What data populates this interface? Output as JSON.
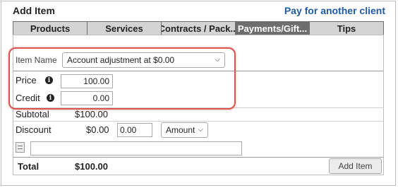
{
  "header": {
    "title": "Add Item",
    "pay_link": "Pay for another client"
  },
  "tabs": [
    {
      "label": "Products",
      "active": false
    },
    {
      "label": "Services",
      "active": false
    },
    {
      "label": "Contracts / Pack...",
      "active": false
    },
    {
      "label": "Payments/Gift...",
      "active": true
    },
    {
      "label": "Tips",
      "active": false
    }
  ],
  "form": {
    "item_name_label": "Item Name",
    "item_name_value": "Account adjustment at $0.00",
    "price_label": "Price",
    "price_value": "100.00",
    "credit_label": "Credit",
    "credit_value": "0.00",
    "subtotal_label": "Subtotal",
    "subtotal_value": "$100.00",
    "discount_label": "Discount",
    "discount_amount": "$0.00",
    "discount_input": "0.00",
    "discount_type": "Amount",
    "note_value": ""
  },
  "footer": {
    "total_label": "Total",
    "total_value": "$100.00",
    "add_button": "Add Item"
  },
  "colors": {
    "highlight": "#d9534f",
    "link": "#1f5aa6",
    "active_tab": "#6e6e6e"
  },
  "icons": {
    "info": "info-icon",
    "chevron": "chevron-down-icon",
    "note": "note-icon"
  }
}
